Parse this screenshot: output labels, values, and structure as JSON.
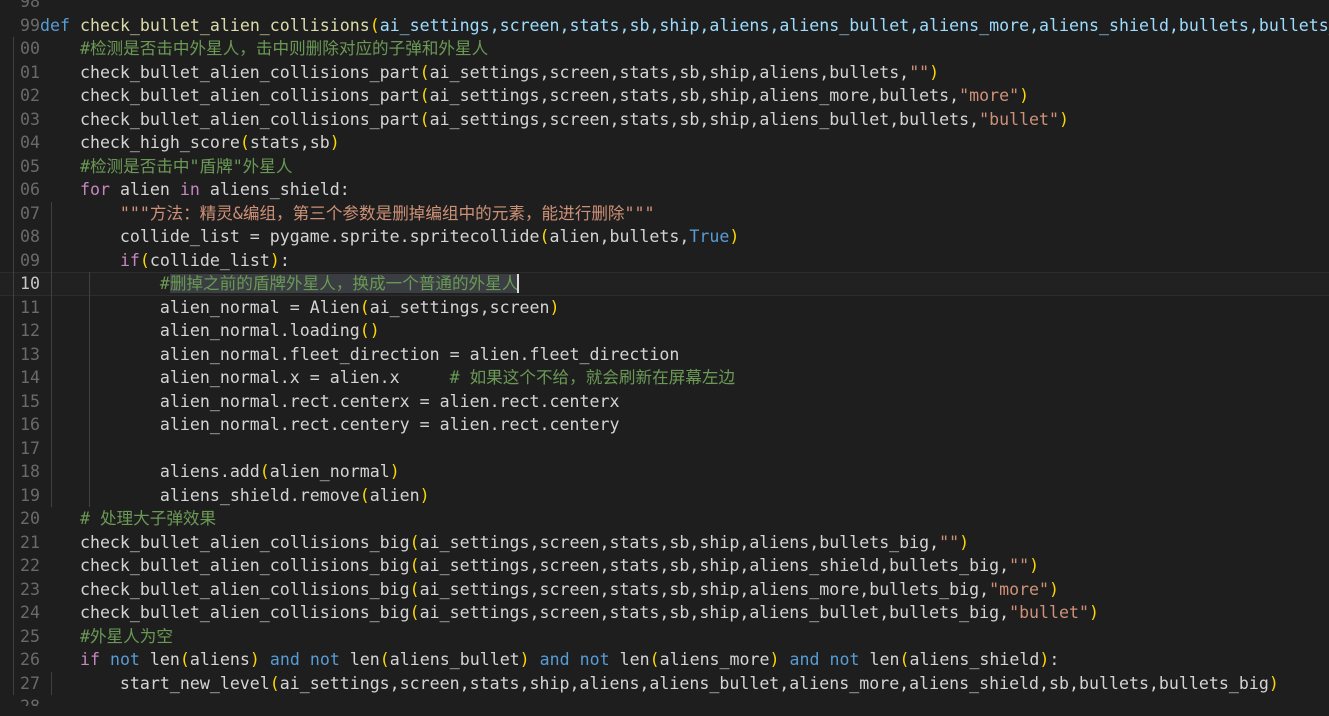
{
  "editor": {
    "name": "code-editor",
    "language": "Python",
    "theme": "Dark+ (default dark)",
    "colors": {
      "background": "#1e1e1e",
      "foreground": "#d4d4d4",
      "gutter_foreground": "#6a6a6a",
      "gutter_active_foreground": "#c6c6c6",
      "current_line_background": "#212121",
      "selection_background": "#3a3d41",
      "indent_guide": "#404040",
      "cursor": "#dcdcdc",
      "keyword": "#569cd6",
      "control_keyword": "#c586c0",
      "function": "#dcdcaa",
      "parameter": "#9cdcfe",
      "string": "#ce9178",
      "comment": "#6a9955",
      "bracket": "#ffd700"
    },
    "cursor_line": 10,
    "cursor_line_number_label": "10"
  },
  "gutter": {
    "name": "line-number-gutter",
    "note": "line numbers clipped to last two digits at left edge",
    "numbers": [
      "98",
      "99",
      "00",
      "01",
      "02",
      "03",
      "04",
      "05",
      "06",
      "07",
      "08",
      "09",
      "10",
      "11",
      "12",
      "13",
      "14",
      "15",
      "16",
      "17",
      "18",
      "19",
      "20",
      "21",
      "22",
      "23",
      "24",
      "25",
      "26",
      "27",
      "28"
    ]
  },
  "lines": [
    {
      "n": "98",
      "text": ""
    },
    {
      "n": "99",
      "text": "def check_bullet_alien_collisions(ai_settings,screen,stats,sb,ship,aliens,aliens_bullet,aliens_more,aliens_shield,bullets,bullets_big"
    },
    {
      "n": "00",
      "text": "    #检测是否击中外星人，击中则删除对应的子弹和外星人"
    },
    {
      "n": "01",
      "text": "    check_bullet_alien_collisions_part(ai_settings,screen,stats,sb,ship,aliens,bullets,\"\")"
    },
    {
      "n": "02",
      "text": "    check_bullet_alien_collisions_part(ai_settings,screen,stats,sb,ship,aliens_more,bullets,\"more\")"
    },
    {
      "n": "03",
      "text": "    check_bullet_alien_collisions_part(ai_settings,screen,stats,sb,ship,aliens_bullet,bullets,\"bullet\")"
    },
    {
      "n": "04",
      "text": "    check_high_score(stats,sb)"
    },
    {
      "n": "05",
      "text": "    #检测是否击中\"盾牌\"外星人"
    },
    {
      "n": "06",
      "text": "    for alien in aliens_shield:"
    },
    {
      "n": "07",
      "text": "        \"\"\"方法：精灵&编组，第三个参数是删掉编组中的元素，能进行删除\"\"\""
    },
    {
      "n": "08",
      "text": "        collide_list = pygame.sprite.spritecollide(alien,bullets,True)"
    },
    {
      "n": "09",
      "text": "        if(collide_list):"
    },
    {
      "n": "10",
      "text": "            #删掉之前的盾牌外星人，换成一个普通的外星人"
    },
    {
      "n": "11",
      "text": "            alien_normal = Alien(ai_settings,screen)"
    },
    {
      "n": "12",
      "text": "            alien_normal.loading()"
    },
    {
      "n": "13",
      "text": "            alien_normal.fleet_direction = alien.fleet_direction"
    },
    {
      "n": "14",
      "text": "            alien_normal.x = alien.x     # 如果这个不给，就会刷新在屏幕左边"
    },
    {
      "n": "15",
      "text": "            alien_normal.rect.centerx = alien.rect.centerx"
    },
    {
      "n": "16",
      "text": "            alien_normal.rect.centery = alien.rect.centery"
    },
    {
      "n": "17",
      "text": ""
    },
    {
      "n": "18",
      "text": "            aliens.add(alien_normal)"
    },
    {
      "n": "19",
      "text": "            aliens_shield.remove(alien)"
    },
    {
      "n": "20",
      "text": "    # 处理大子弹效果"
    },
    {
      "n": "21",
      "text": "    check_bullet_alien_collisions_big(ai_settings,screen,stats,sb,ship,aliens,bullets_big,\"\")"
    },
    {
      "n": "22",
      "text": "    check_bullet_alien_collisions_big(ai_settings,screen,stats,sb,ship,aliens_shield,bullets_big,\"\")"
    },
    {
      "n": "23",
      "text": "    check_bullet_alien_collisions_big(ai_settings,screen,stats,sb,ship,aliens_more,bullets_big,\"more\")"
    },
    {
      "n": "24",
      "text": "    check_bullet_alien_collisions_big(ai_settings,screen,stats,sb,ship,aliens_bullet,bullets_big,\"bullet\")"
    },
    {
      "n": "25",
      "text": "    #外星人为空"
    },
    {
      "n": "26",
      "text": "    if not len(aliens) and not len(aliens_bullet) and not len(aliens_more) and not len(aliens_shield):"
    },
    {
      "n": "27",
      "text": "        start_new_level(ai_settings,screen,stats,ship,aliens,aliens_bullet,aliens_more,aliens_shield,sb,bullets,bullets_big)"
    },
    {
      "n": "28",
      "text": ""
    }
  ],
  "selection": {
    "name": "text-selection",
    "line": "10",
    "text": "删掉之前的盾牌外星人，换成一个普通的外星人"
  }
}
